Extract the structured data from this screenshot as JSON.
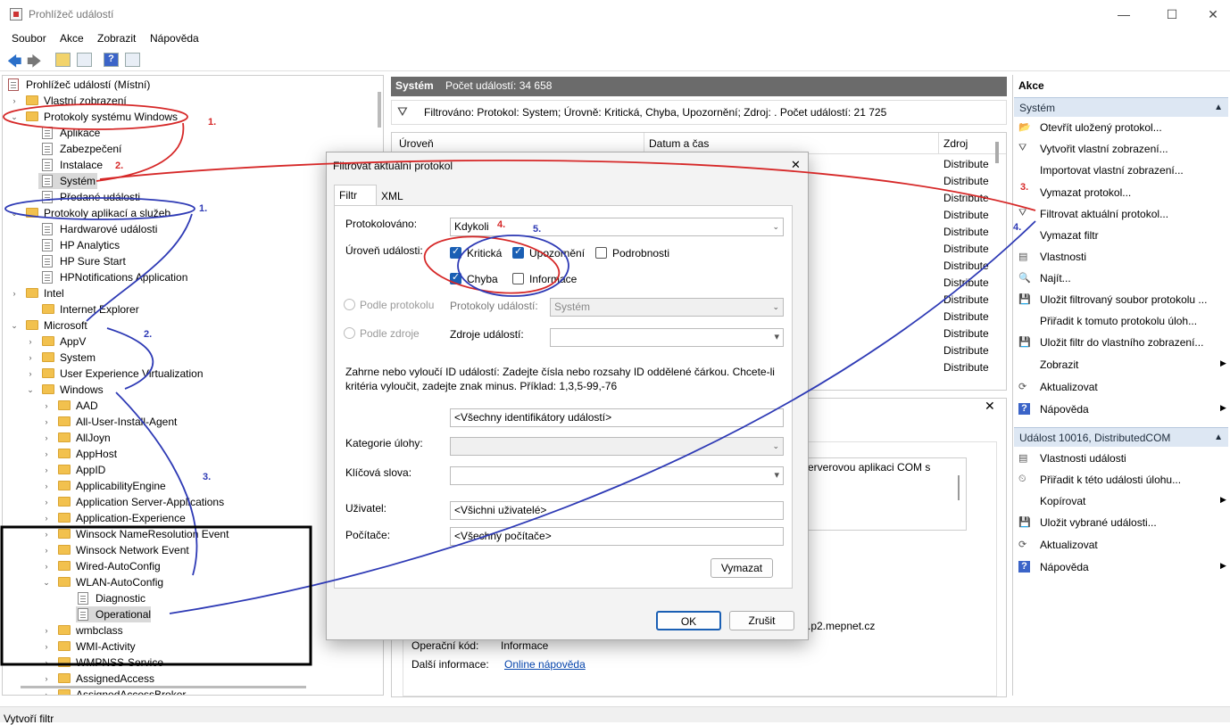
{
  "window": {
    "title": "Prohlížeč událostí",
    "minimize": "—",
    "maximize": "☐",
    "close": "✕"
  },
  "menu": {
    "file": "Soubor",
    "action": "Akce",
    "view": "Zobrazit",
    "help": "Nápověda"
  },
  "tree": {
    "root": "Prohlížeč událostí (Místní)",
    "custom_views": "Vlastní zobrazení",
    "windows_logs": "Protokoly systému Windows",
    "app_log": "Aplikace",
    "security": "Zabezpečení",
    "setup": "Instalace",
    "system": "Systém",
    "forwarded": "Předané události",
    "apps_services": "Protokoly aplikací a služeb",
    "items": [
      "Hardwarové události",
      "HP Analytics",
      "HP Sure Start",
      "HPNotifications Application",
      "Intel",
      "Internet Explorer",
      "Microsoft",
      "AppV",
      "System",
      "User Experience Virtualization",
      "Windows",
      "AAD",
      "All-User-Install-Agent",
      "AllJoyn",
      "AppHost",
      "AppID",
      "ApplicabilityEngine",
      "Application Server-Applications",
      "Application-Experience",
      "Winsock NameResolution Event",
      "Winsock Network Event",
      "Wired-AutoConfig",
      "WLAN-AutoConfig",
      "Diagnostic",
      "Operational",
      "wmbclass",
      "WMI-Activity",
      "WMPNSS-Service",
      "AssignedAccess",
      "AssignedAccessBroker"
    ]
  },
  "center": {
    "header_title": "Systém",
    "header_count": "Počet událostí: 34 658",
    "filter_text": "Filtrováno: Protokol: System; Úrovně: Kritická, Chyba, Upozornění; Zdroj: . Počet událostí: 21 725",
    "col_level": "Úroveň",
    "col_date": "Datum a čas",
    "col_source": "Zdroj",
    "source_value": "Distribute",
    "source_count": "13",
    "detail_text": "erverovou aplikaci COM s",
    "detail_host": ".p2.mepnet.cz",
    "opcode_label": "Operační kód:",
    "opcode_value": "Informace",
    "more_label": "Další informace:",
    "more_link": "Online nápověda",
    "close_x": "✕"
  },
  "actions": {
    "title": "Akce",
    "section1": "Systém",
    "section2": "Událost 10016, DistributedCOM",
    "items": [
      "Otevřít uložený protokol...",
      "Vytvořit vlastní zobrazení...",
      "Importovat vlastní zobrazení...",
      "Vymazat protokol...",
      "Filtrovat aktuální protokol...",
      "Vymazat filtr",
      "Vlastnosti",
      "Najít...",
      "Uložit filtrovaný soubor protokolu ...",
      "Přiřadit k tomuto protokolu úloh...",
      "Uložit filtr do vlastního zobrazení...",
      "Zobrazit",
      "Aktualizovat",
      "Nápověda"
    ],
    "event_items": [
      "Vlastnosti události",
      "Přiřadit k této události úlohu...",
      "Kopírovat",
      "Uložit vybrané události...",
      "Aktualizovat",
      "Nápověda"
    ]
  },
  "dialog": {
    "title": "Filtrovat aktuální protokol",
    "tab_filter": "Filtr",
    "tab_xml": "XML",
    "logged_label": "Protokolováno:",
    "logged_value": "Kdykoli",
    "level_label": "Úroveň události:",
    "cb_critical": "Kritická",
    "cb_warning": "Upozornění",
    "cb_verbose": "Podrobnosti",
    "cb_error": "Chyba",
    "cb_info": "Informace",
    "by_log": "Podle protokolu",
    "by_source": "Podle zdroje",
    "event_logs_label": "Protokoly událostí:",
    "event_logs_value": "Systém",
    "event_sources_label": "Zdroje událostí:",
    "id_help": "Zahrne nebo vyloučí ID událostí: Zadejte čísla nebo rozsahy ID oddělené čárkou. Chcete-li kritéria vyloučit, zadejte znak minus. Příklad: 1,3,5-99,-76",
    "id_value": "<Všechny identifikátory událostí>",
    "task_label": "Kategorie úlohy:",
    "keywords_label": "Klíčová slova:",
    "user_label": "Uživatel:",
    "user_value": "<Všichni uživatelé>",
    "computer_label": "Počítače:",
    "computer_value": "<Všechny počítače>",
    "clear_btn": "Vymazat",
    "ok_btn": "OK",
    "cancel_btn": "Zrušit",
    "close_x": "✕"
  },
  "annotations": {
    "red1": "1.",
    "red2": "2.",
    "red3": "3.",
    "red4": "4.",
    "blue1": "1.",
    "blue2": "2.",
    "blue3": "3.",
    "blue4": "4.",
    "blue5": "5."
  },
  "status": {
    "text": "Vytvoří filtr"
  }
}
